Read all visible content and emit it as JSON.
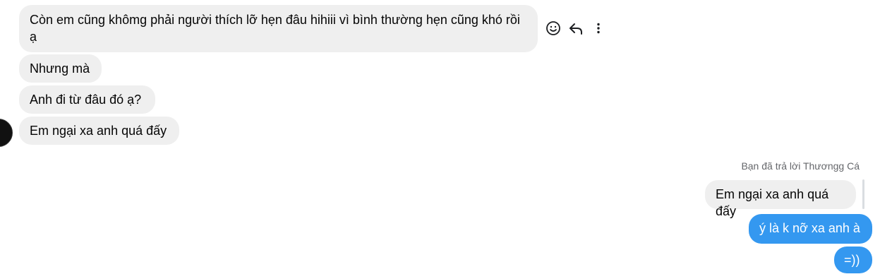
{
  "messages_incoming": [
    {
      "text": "Còn em cũng khômg phải người thích lỡ hẹn đâu hihiii vì bình thường hẹn cũng khó rồi ạ"
    },
    {
      "text": "Nhưng mà"
    },
    {
      "text": "Anh đi từ đâu đó ạ?"
    },
    {
      "text": "Em ngại xa anh quá đấy"
    }
  ],
  "message_actions": {
    "react_icon": "smiley-icon",
    "reply_icon": "reply-arrow-icon",
    "more_icon": "vertical-ellipsis-icon"
  },
  "reply": {
    "label": "Bạn đã trả lời Thươngg Cá",
    "quoted_text": "Em ngại xa anh quá đấy"
  },
  "messages_outgoing": [
    {
      "text": "ý là k nỡ xa anh à"
    },
    {
      "text": "=))"
    }
  ],
  "colors": {
    "incoming_bg": "#efefef",
    "outgoing_bg": "#3498f0",
    "muted_text": "#65676b"
  }
}
